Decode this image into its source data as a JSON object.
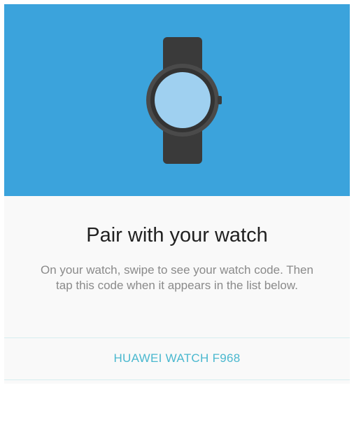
{
  "hero": {
    "icon": "smartwatch-icon",
    "background_color": "#3ba3dc",
    "watch_screen_color": "#9fd0f0",
    "watch_body_color": "#3b3b3b"
  },
  "pairing": {
    "title": "Pair with your watch",
    "description": "On your watch, swipe to see your watch code. Then tap this code when it appears in the list below."
  },
  "devices": [
    {
      "label": "HUAWEI WATCH F968"
    }
  ],
  "accent_color": "#4ab8cf"
}
